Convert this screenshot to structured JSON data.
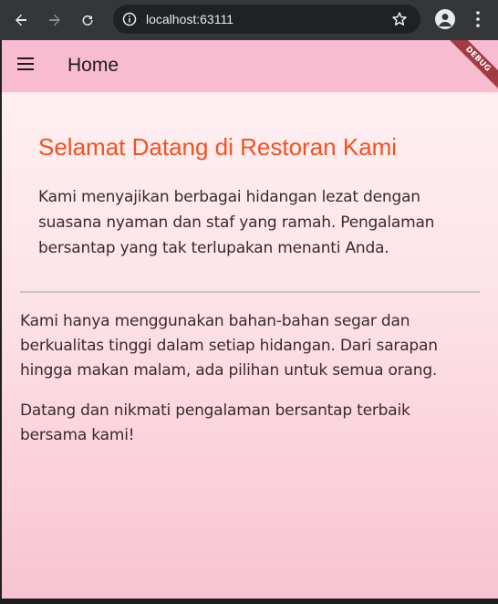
{
  "browser": {
    "url": "localhost:63111"
  },
  "appbar": {
    "title": "Home",
    "debug_label": "DEBUG"
  },
  "main": {
    "welcome_title": "Selamat Datang di Restoran Kami",
    "intro_text": "Kami menyajikan berbagai hidangan lezat dengan suasana nyaman dan staf yang ramah. Pengalaman bersantap yang tak terlupakan menanti Anda.",
    "paragraph1": "Kami hanya menggunakan bahan-bahan segar dan berkualitas tinggi dalam setiap hidangan. Dari sarapan hingga makan malam, ada pilihan untuk semua orang.",
    "paragraph2": "Datang dan nikmati pengalaman bersantap terbaik bersama kami!"
  },
  "colors": {
    "appbar_bg": "#f8bbd0",
    "title_accent": "#f4511e",
    "debug_ribbon": "#a23b43"
  }
}
